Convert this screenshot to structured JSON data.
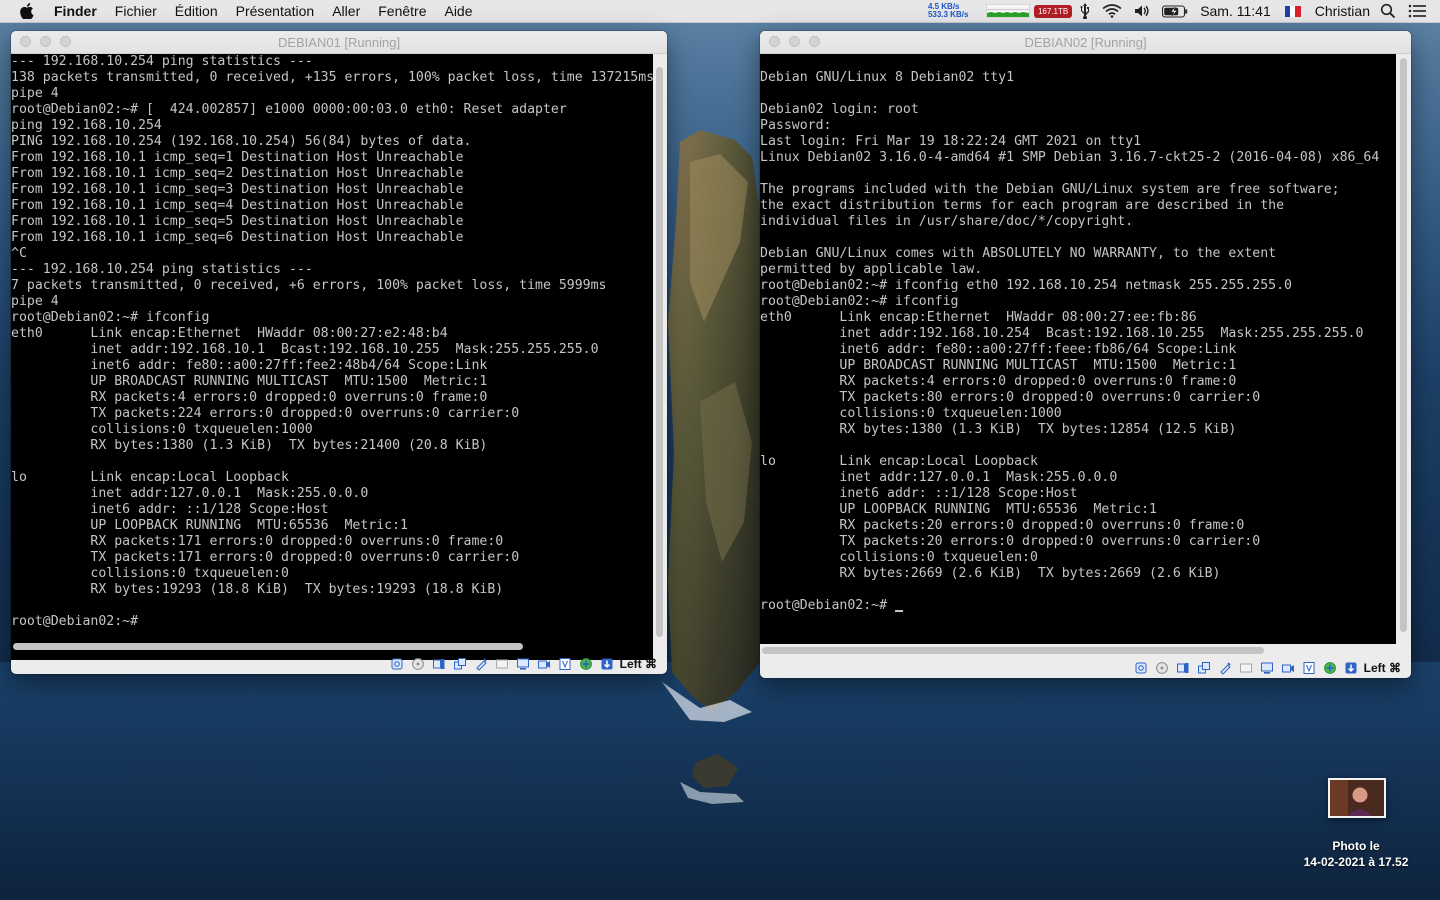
{
  "menubar": {
    "app_name": "Finder",
    "menus": [
      "Fichier",
      "Édition",
      "Présentation",
      "Aller",
      "Fenêtre",
      "Aide"
    ],
    "net_upload": "4.5 KB/s",
    "net_download": "533.3 KB/s",
    "temperature": "167.1TB",
    "clock": "Sam. 11:41",
    "user": "Christian",
    "icons": [
      "apple-icon",
      "network-graph-icon",
      "usb-icon",
      "wifi-icon",
      "volume-icon",
      "battery-icon",
      "french-flag-icon",
      "search-icon",
      "list-icon"
    ]
  },
  "window1": {
    "title": "DEBIAN01 [Running]",
    "terminal_lines": [
      "--- 192.168.10.254 ping statistics ---",
      "138 packets transmitted, 0 received, +135 errors, 100% packet loss, time 137215ms",
      "pipe 4",
      "root@Debian02:~# [  424.002857] e1000 0000:00:03.0 eth0: Reset adapter",
      "ping 192.168.10.254",
      "PING 192.168.10.254 (192.168.10.254) 56(84) bytes of data.",
      "From 192.168.10.1 icmp_seq=1 Destination Host Unreachable",
      "From 192.168.10.1 icmp_seq=2 Destination Host Unreachable",
      "From 192.168.10.1 icmp_seq=3 Destination Host Unreachable",
      "From 192.168.10.1 icmp_seq=4 Destination Host Unreachable",
      "From 192.168.10.1 icmp_seq=5 Destination Host Unreachable",
      "From 192.168.10.1 icmp_seq=6 Destination Host Unreachable",
      "^C",
      "--- 192.168.10.254 ping statistics ---",
      "7 packets transmitted, 0 received, +6 errors, 100% packet loss, time 5999ms",
      "pipe 4",
      "root@Debian02:~# ifconfig",
      "eth0      Link encap:Ethernet  HWaddr 08:00:27:e2:48:b4",
      "          inet addr:192.168.10.1  Bcast:192.168.10.255  Mask:255.255.255.0",
      "          inet6 addr: fe80::a00:27ff:fee2:48b4/64 Scope:Link",
      "          UP BROADCAST RUNNING MULTICAST  MTU:1500  Metric:1",
      "          RX packets:4 errors:0 dropped:0 overruns:0 frame:0",
      "          TX packets:224 errors:0 dropped:0 overruns:0 carrier:0",
      "          collisions:0 txqueuelen:1000",
      "          RX bytes:1380 (1.3 KiB)  TX bytes:21400 (20.8 KiB)",
      "",
      "lo        Link encap:Local Loopback",
      "          inet addr:127.0.0.1  Mask:255.0.0.0",
      "          inet6 addr: ::1/128 Scope:Host",
      "          UP LOOPBACK RUNNING  MTU:65536  Metric:1",
      "          RX packets:171 errors:0 dropped:0 overruns:0 frame:0",
      "          TX packets:171 errors:0 dropped:0 overruns:0 carrier:0",
      "          collisions:0 txqueuelen:0",
      "          RX bytes:19293 (18.8 KiB)  TX bytes:19293 (18.8 KiB)",
      "",
      "root@Debian02:~#"
    ],
    "host_key": "Left ⌘"
  },
  "window2": {
    "title": "DEBIAN02 [Running]",
    "terminal_lines": [
      "",
      "Debian GNU/Linux 8 Debian02 tty1",
      "",
      "Debian02 login: root",
      "Password:",
      "Last login: Fri Mar 19 18:22:24 GMT 2021 on tty1",
      "Linux Debian02 3.16.0-4-amd64 #1 SMP Debian 3.16.7-ckt25-2 (2016-04-08) x86_64",
      "",
      "The programs included with the Debian GNU/Linux system are free software;",
      "the exact distribution terms for each program are described in the",
      "individual files in /usr/share/doc/*/copyright.",
      "",
      "Debian GNU/Linux comes with ABSOLUTELY NO WARRANTY, to the extent",
      "permitted by applicable law.",
      "root@Debian02:~# ifconfig eth0 192.168.10.254 netmask 255.255.255.0",
      "root@Debian02:~# ifconfig",
      "eth0      Link encap:Ethernet  HWaddr 08:00:27:ee:fb:86",
      "          inet addr:192.168.10.254  Bcast:192.168.10.255  Mask:255.255.255.0",
      "          inet6 addr: fe80::a00:27ff:feee:fb86/64 Scope:Link",
      "          UP BROADCAST RUNNING MULTICAST  MTU:1500  Metric:1",
      "          RX packets:4 errors:0 dropped:0 overruns:0 frame:0",
      "          TX packets:80 errors:0 dropped:0 overruns:0 carrier:0",
      "          collisions:0 txqueuelen:1000",
      "          RX bytes:1380 (1.3 KiB)  TX bytes:12854 (12.5 KiB)",
      "",
      "lo        Link encap:Local Loopback",
      "          inet addr:127.0.0.1  Mask:255.0.0.0",
      "          inet6 addr: ::1/128 Scope:Host",
      "          UP LOOPBACK RUNNING  MTU:65536  Metric:1",
      "          RX packets:20 errors:0 dropped:0 overruns:0 frame:0",
      "          TX packets:20 errors:0 dropped:0 overruns:0 carrier:0",
      "          collisions:0 txqueuelen:0",
      "          RX bytes:2669 (2.6 KiB)  TX bytes:2669 (2.6 KiB)",
      "",
      "root@Debian02:~# "
    ],
    "host_key": "Left ⌘"
  },
  "statusbar_icons": [
    "hard-disk-icon",
    "optical-drive-icon",
    "audio-icon",
    "network-icon",
    "usb-icon",
    "shared-folder-icon",
    "display-icon",
    "video-capture-icon",
    "cpu-icon",
    "recording-icon",
    "mouse-integration-icon"
  ],
  "desktop_photo": {
    "label_line1": "Photo le",
    "label_line2": "14-02-2021 à 17.52"
  },
  "colors": {
    "terminal_bg": "#000000",
    "terminal_fg": "#c5c5c5",
    "menubar_bg": "#e6e6e8",
    "window_chrome": "#ececec",
    "temp_badge": "#b31d26",
    "net_text": "#1a56c8"
  }
}
